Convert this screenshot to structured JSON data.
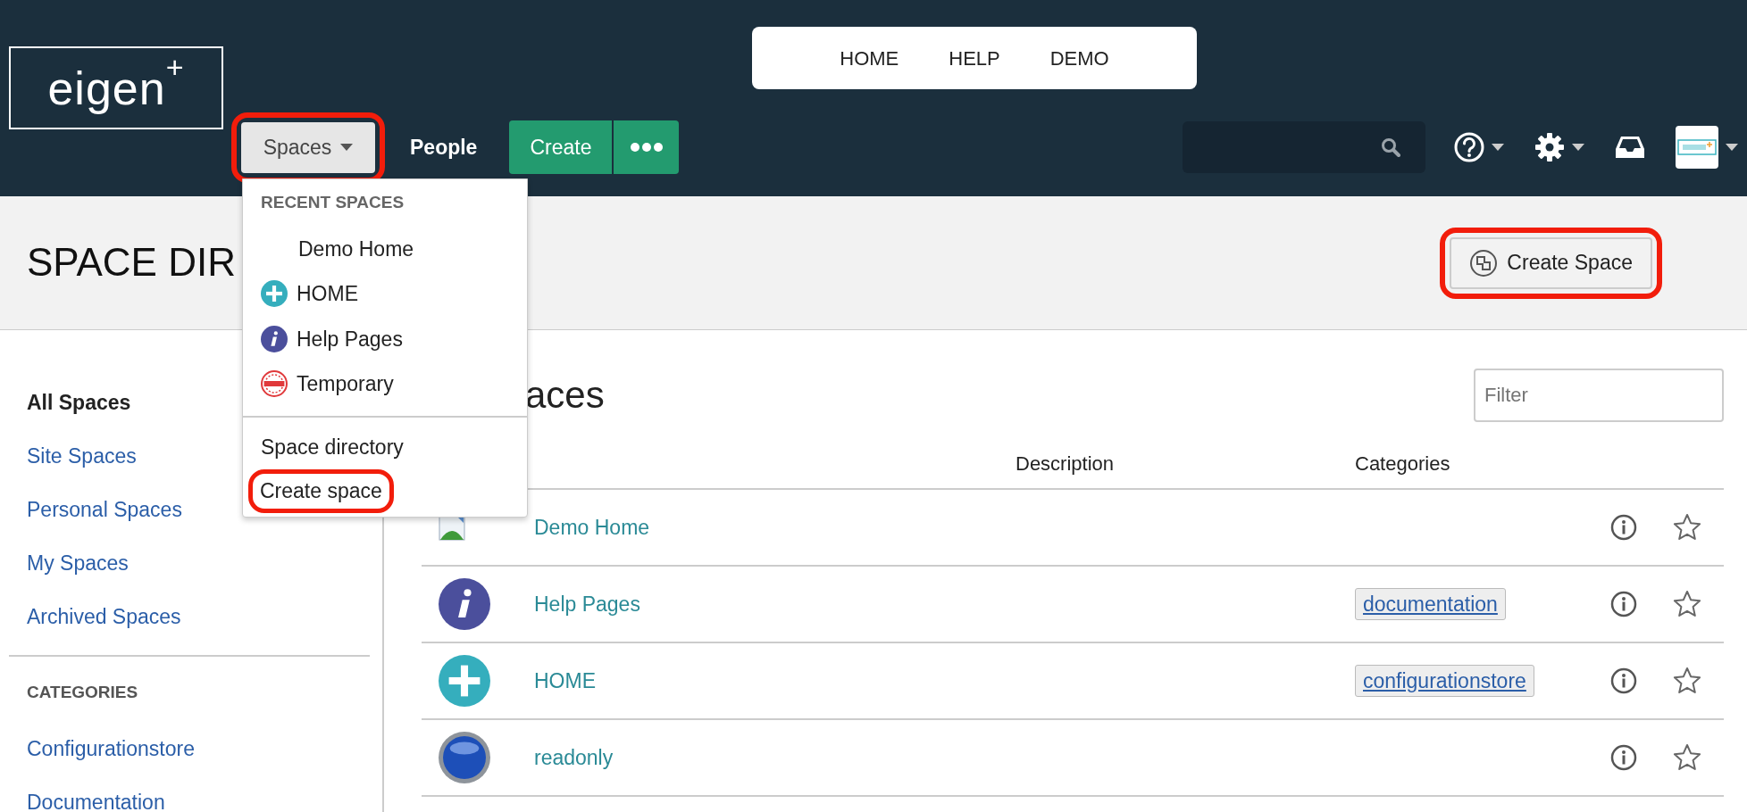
{
  "logo": {
    "text": "eigen$^{+}$"
  },
  "top_links": [
    {
      "label": "HOME"
    },
    {
      "label": "HELP"
    },
    {
      "label": "DEMO"
    }
  ],
  "nav": {
    "spaces": {
      "label": "Spaces",
      "expanded": true,
      "highlighted": true
    },
    "people": "People",
    "create": "Create"
  },
  "dropdown": {
    "heading": "RECENT SPACES",
    "recent": [
      {
        "label": "Demo Home",
        "kind": "plain"
      },
      {
        "label": "HOME",
        "kind": "plus"
      },
      {
        "label": "Help Pages",
        "kind": "info"
      },
      {
        "label": "Temporary",
        "kind": "stamp"
      }
    ],
    "actions": [
      {
        "label": "Space directory",
        "highlighted": false
      },
      {
        "label": "Create space",
        "highlighted": true
      }
    ]
  },
  "page_title": "SPACE DIR",
  "create_space_button": {
    "label": "Create Space",
    "highlighted": true
  },
  "sidebar": {
    "items": [
      {
        "label": "All Spaces",
        "selected": true
      },
      {
        "label": "Site Spaces",
        "selected": false
      },
      {
        "label": "Personal Spaces",
        "selected": false
      },
      {
        "label": "My Spaces",
        "selected": false
      },
      {
        "label": "Archived Spaces",
        "selected": false
      }
    ],
    "categories_heading": "CATEGORIES",
    "categories": [
      "Configurationstore",
      "Documentation"
    ]
  },
  "main": {
    "heading": "aces",
    "filter": {
      "placeholder": "Filter"
    },
    "columns": [
      "Description",
      "Categories"
    ],
    "rows": [
      {
        "kind": "broken",
        "name": "Demo Home",
        "starred": false
      },
      {
        "kind": "info",
        "name": "Help Pages",
        "category": "documentation",
        "starred": false
      },
      {
        "kind": "plus",
        "name": "HOME",
        "category": "configurationstore",
        "starred": false
      },
      {
        "kind": "demo",
        "name": "readonly",
        "starred": false
      }
    ]
  }
}
